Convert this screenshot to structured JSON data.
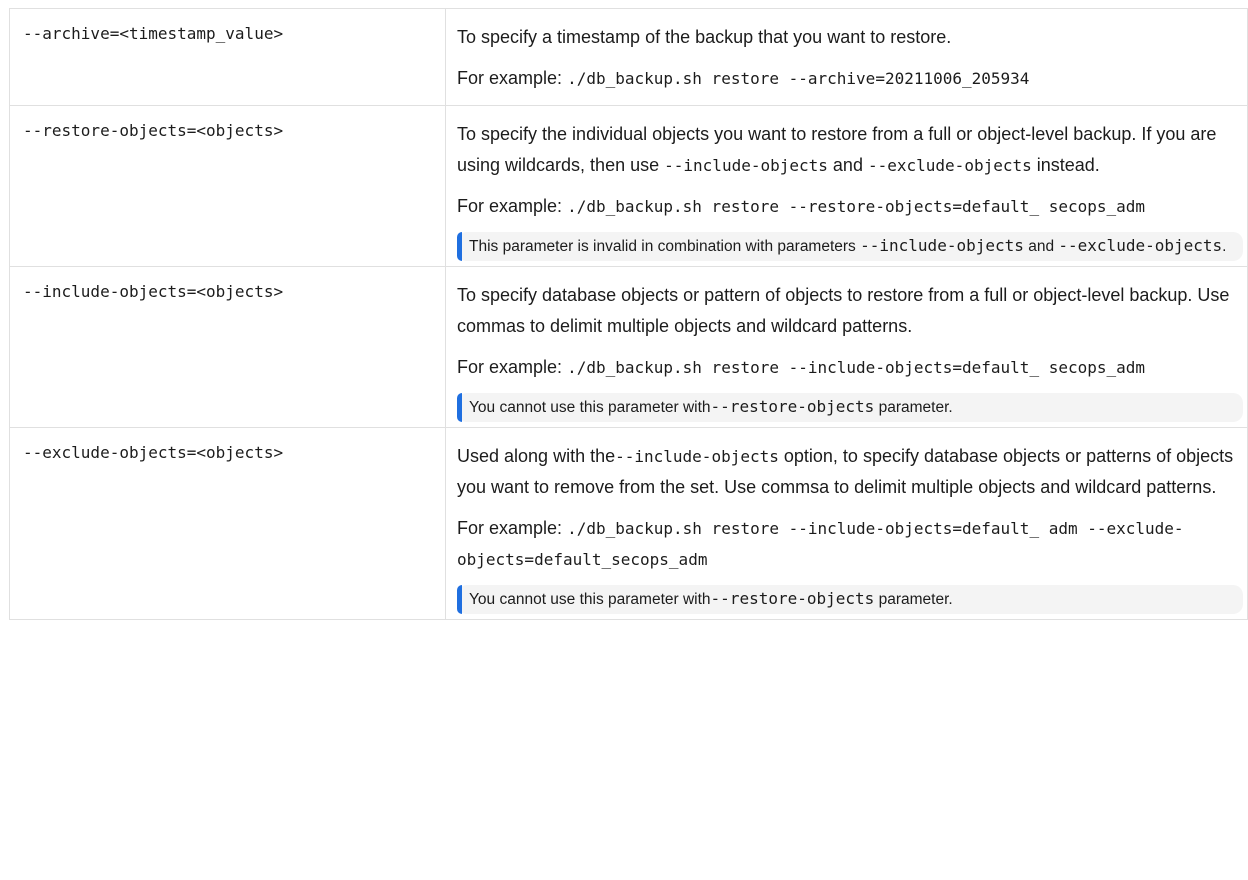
{
  "rows": [
    {
      "name": "--archive=<timestamp_value>",
      "description": "To specify a timestamp of the backup that you want to restore.",
      "example_prefix": "For example:",
      "example_code": "./db_backup.sh restore --archive=20211006_205934"
    },
    {
      "name": "--restore-objects=<objects>",
      "description_before": "To specify the individual objects you want to restore from a full or object-level backup. If you are using wildcards, then use",
      "description_code_1": "--include-objects",
      "description_mid": "and",
      "description_code_2": "--exclude-objects",
      "description_after": "instead.",
      "example_prefix": "For example:",
      "example_code": "./db_backup.sh restore --restore-objects=default_ secops_adm",
      "note": {
        "text_before": "This parameter is invalid in combination with parameters",
        "code_1": "--include-objects",
        "text_mid": "and",
        "code_2": "--exclude-objects",
        "text_after": "."
      }
    },
    {
      "name": "--include-objects=<objects>",
      "description": "To specify database objects or pattern of objects to restore from a full or object-level backup. Use commas to delimit multiple objects and wildcard patterns.",
      "example_prefix": "For example:",
      "example_code": "./db_backup.sh restore --include-objects=default_ secops_adm",
      "note": {
        "text_before": "You cannot use this parameter with",
        "code": "--restore-objects",
        "text_after": "parameter."
      }
    },
    {
      "name": "--exclude-objects=<objects>",
      "description_before": "Used along with the",
      "description_code": "--include-objects",
      "description_after": "option, to specify database objects or patterns of objects you want to remove from the set. Use commsa to delimit multiple objects and wildcard patterns.",
      "example_prefix": "For example:",
      "example_code": "./db_backup.sh restore --include-objects=default_ adm --exclude-objects=default_secops_adm",
      "note": {
        "text_before": "You cannot use this parameter with",
        "code": "--restore-objects",
        "text_after": "parameter."
      }
    }
  ],
  "colors": {
    "border": "#e0e0e0",
    "note_background": "#f4f4f4",
    "note_accent": "#1f6fe0",
    "text": "#1c1c1c"
  }
}
